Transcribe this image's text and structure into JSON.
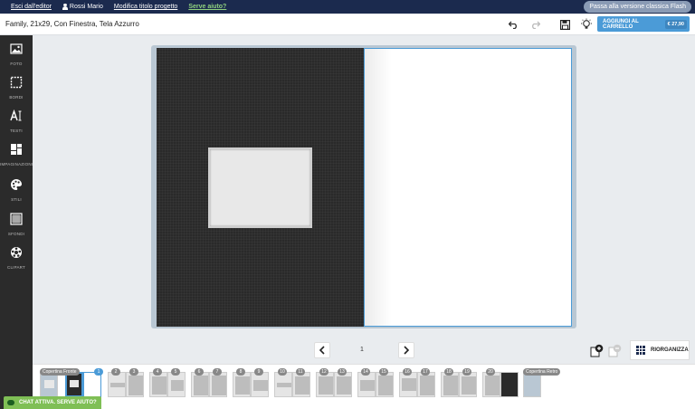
{
  "topbar": {
    "exit_label": "Esci dall'editor",
    "user_name": "Rossi Mario",
    "rename_label": "Modifica titolo progetto",
    "help_label": "Serve aiuto?",
    "flash_label": "Passa alla versione classica Flash"
  },
  "toolbar": {
    "project_title": "Family, 21x29, Con Finestra, Tela Azzurro",
    "cart_label": "AGGIUNGI AL CARRELLO",
    "price": "€ 27,90"
  },
  "sidebar": {
    "items": [
      {
        "label": "FOTO",
        "icon": "image-icon"
      },
      {
        "label": "BORDI",
        "icon": "border-icon"
      },
      {
        "label": "TESTI",
        "icon": "text-icon"
      },
      {
        "label": "IMPAGINAZIONI",
        "icon": "layout-icon"
      },
      {
        "label": "STILI",
        "icon": "palette-icon"
      },
      {
        "label": "SFONDI",
        "icon": "background-icon"
      },
      {
        "label": "CLIPART",
        "icon": "clipart-icon"
      }
    ]
  },
  "pager": {
    "current_page": "1"
  },
  "tools": {
    "reorganize_label": "RIORGANIZZA"
  },
  "filmstrip": {
    "cover_front_label": "Copertina Fronte",
    "cover_back_label": "Copertina Retro",
    "pages": [
      "1",
      "2",
      "3",
      "4",
      "5",
      "6",
      "7",
      "8",
      "9",
      "10",
      "11",
      "12",
      "13",
      "14",
      "15",
      "16",
      "17",
      "18",
      "19",
      "20"
    ]
  },
  "chat": {
    "label": "CHAT ATTIVA. SERVE AIUTO?"
  },
  "colors": {
    "navy": "#1b2a4e",
    "accent": "#4b9bd7",
    "chat_green": "#7fbf55"
  }
}
